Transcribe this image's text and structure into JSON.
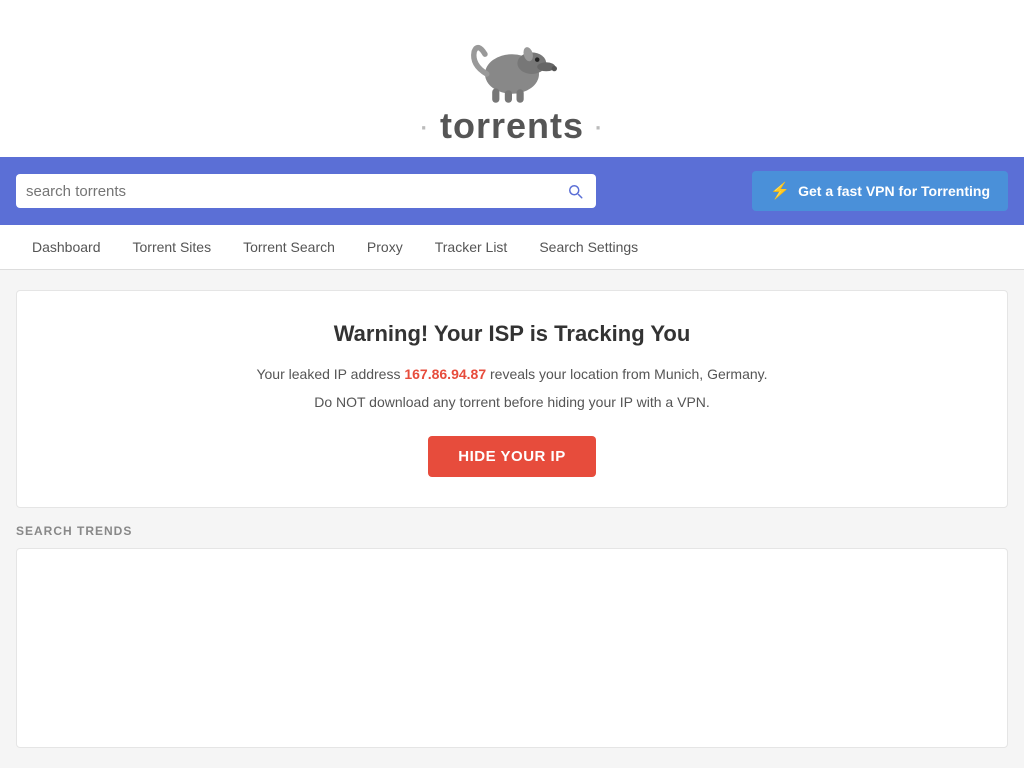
{
  "header": {
    "logo_text": "torrents",
    "logo_dots_left": "·",
    "logo_dots_right": "·"
  },
  "search_bar": {
    "placeholder": "search torrents",
    "vpn_button_label": "Get a fast VPN for Torrenting",
    "vpn_icon": "lightning-icon"
  },
  "nav": {
    "items": [
      {
        "id": "dashboard",
        "label": "Dashboard"
      },
      {
        "id": "torrent-sites",
        "label": "Torrent Sites"
      },
      {
        "id": "torrent-search",
        "label": "Torrent Search"
      },
      {
        "id": "proxy",
        "label": "Proxy"
      },
      {
        "id": "tracker-list",
        "label": "Tracker List"
      },
      {
        "id": "search-settings",
        "label": "Search Settings"
      }
    ]
  },
  "warning": {
    "title": "Warning! Your ISP is Tracking You",
    "line1_prefix": "Your leaked IP address ",
    "ip_address": "167.86.94.87",
    "line1_suffix": " reveals your location from Munich, Germany.",
    "line2": "Do NOT download any torrent before hiding your IP with a VPN.",
    "button_label": "HIDE YOUR IP"
  },
  "search_trends": {
    "label": "SEARCH TRENDS"
  }
}
